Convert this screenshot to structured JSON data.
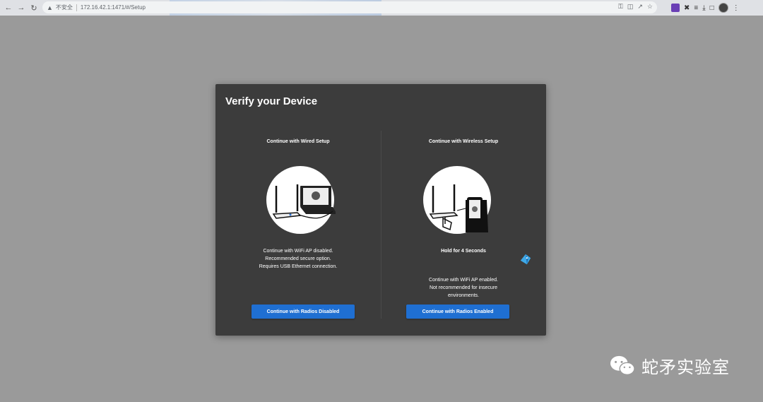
{
  "browser": {
    "security_label": "不安全",
    "url": "172.16.42.1:1471/#/Setup",
    "icons": [
      "back-icon",
      "forward-icon",
      "reload-icon",
      "key-icon",
      "translate-icon",
      "share-icon",
      "star-icon",
      "extension-icon",
      "puzzle-icon",
      "reading-list-icon",
      "download-icon",
      "sidepanel-icon",
      "profile-avatar",
      "menu-icon"
    ]
  },
  "dialog": {
    "title": "Verify your Device",
    "wired": {
      "heading": "Continue with Wired Setup",
      "description": [
        "Continue with WiFi AP disabled.",
        "Recommended secure option.",
        "Requires USB Ethernet connection."
      ],
      "button_label": "Continue with Radios Disabled",
      "illustration": "router-laptop-illustration"
    },
    "wireless": {
      "heading": "Continue with Wireless Setup",
      "hold_text": "Hold for 4 Seconds",
      "description": [
        "Continue with WiFi AP enabled.",
        "Not recommended for insecure",
        "environments."
      ],
      "button_label": "Continue with Radios Enabled",
      "illustration": "router-phone-illustration"
    }
  },
  "watermark": {
    "text": "蛇矛实验室",
    "icon": "wechat-logo"
  },
  "colors": {
    "page_bg": "#9a9a9a",
    "dialog_bg": "#3c3c3c",
    "button_bg": "#1f6fd2"
  }
}
